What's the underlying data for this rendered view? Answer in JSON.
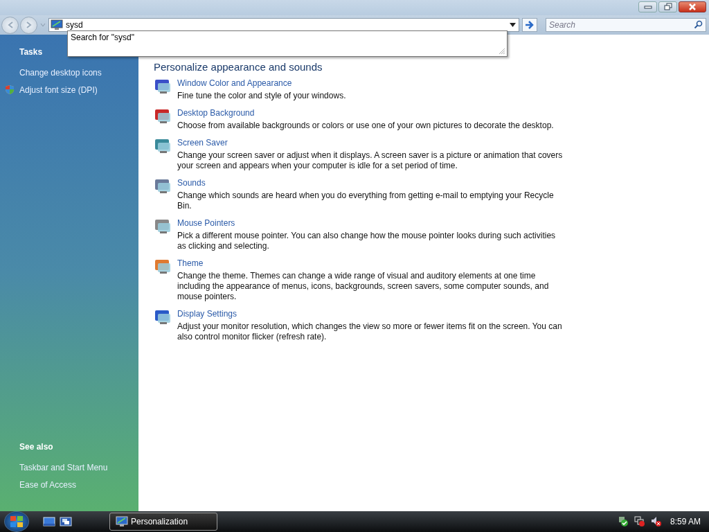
{
  "address_bar": {
    "value": "sysd",
    "suggestion": "Search for \"sysd\""
  },
  "search": {
    "placeholder": "Search"
  },
  "sidebar": {
    "tasks_title": "Tasks",
    "tasks": [
      {
        "label": "Change desktop icons",
        "kind": "link"
      },
      {
        "label": "Adjust font size (DPI)",
        "kind": "shield"
      }
    ],
    "see_also_title": "See also",
    "see_also": [
      "Taskbar and Start Menu",
      "Ease of Access"
    ]
  },
  "main": {
    "heading": "Personalize appearance and sounds",
    "items": [
      {
        "title": "Window Color and Appearance",
        "description": "Fine tune the color and style of your windows."
      },
      {
        "title": "Desktop Background",
        "description": "Choose from available backgrounds or colors or use one of your own pictures to decorate the desktop."
      },
      {
        "title": "Screen Saver",
        "description": "Change your screen saver or adjust when it displays. A screen saver is a picture or animation that covers your screen and appears when your computer is idle for a set period of time."
      },
      {
        "title": "Sounds",
        "description": "Change which sounds are heard when you do everything from getting e-mail to emptying your Recycle Bin."
      },
      {
        "title": "Mouse Pointers",
        "description": "Pick a different mouse pointer. You can also change how the mouse pointer looks during such activities as clicking and selecting."
      },
      {
        "title": "Theme",
        "description": "Change the theme. Themes can change a wide range of visual and auditory elements at one time including the appearance of menus, icons, backgrounds, screen savers, some computer sounds, and mouse pointers."
      },
      {
        "title": "Display Settings",
        "description": "Adjust your monitor resolution, which changes the view so more or fewer items fit on the screen. You can also control monitor flicker (refresh rate)."
      }
    ]
  },
  "taskbar": {
    "tasks": [
      {
        "label": "Personalization",
        "selected": true
      }
    ],
    "clock": "8:59 AM"
  }
}
